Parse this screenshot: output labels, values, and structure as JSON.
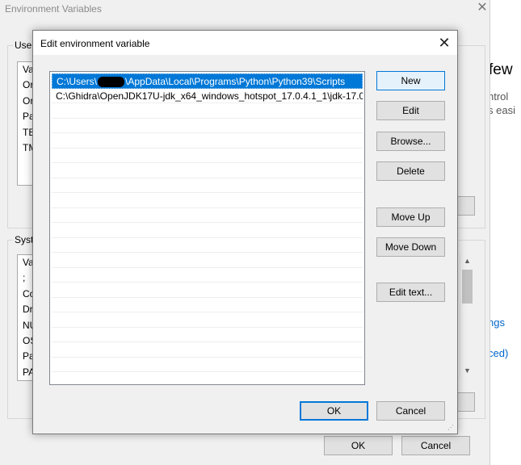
{
  "background_window": {
    "title": "Environment Variables",
    "close_glyph": "✕",
    "user_group_label": "User",
    "user_list_rows": [
      "Va",
      "Or",
      "Or",
      "Pa",
      "TE",
      "TM"
    ],
    "system_group_label": "Syste",
    "system_list_rows": [
      "Va",
      ";",
      "Co",
      "Dr",
      "NU",
      "OS",
      "Pa",
      "PA"
    ],
    "ok_label": "OK",
    "cancel_label": "Cancel"
  },
  "right_panel": {
    "heading_fragment": "few",
    "line1_fragment": "ntrol",
    "line2_fragment": "s easi",
    "link1_fragment": "ngs",
    "link2_fragment": "ced)"
  },
  "dialog": {
    "title": "Edit environment variable",
    "close_glyph": "✕",
    "paths": [
      {
        "prefix": "C:\\Users\\",
        "redacted": true,
        "suffix": "\\AppData\\Local\\Programs\\Python\\Python39\\Scripts",
        "selected": true
      },
      {
        "prefix": "C:\\Ghidra\\OpenJDK17U-jdk_x64_windows_hotspot_17.0.4.1_1\\jdk-17.0....",
        "redacted": false,
        "suffix": "",
        "selected": false
      }
    ],
    "empty_rows": 21,
    "buttons": {
      "new": "New",
      "edit": "Edit",
      "browse": "Browse...",
      "delete": "Delete",
      "move_up": "Move Up",
      "move_down": "Move Down",
      "edit_text": "Edit text...",
      "ok": "OK",
      "cancel": "Cancel"
    }
  },
  "colors": {
    "selection": "#0078d7",
    "link": "#0066cc",
    "window_bg": "#f0f0f0"
  }
}
